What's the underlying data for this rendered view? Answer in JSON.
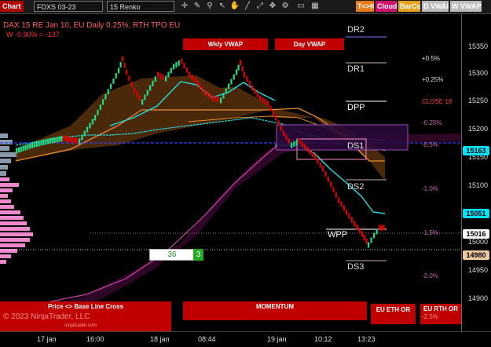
{
  "toolbar": {
    "tab": "Chart",
    "instrument": "FDXS 03-23",
    "bar_type": "15 Renko",
    "badge_tick": "T<>K",
    "badge_cloud": "Cloud",
    "badge_barcol": "BarCol",
    "badge_dvwap": "D VWAP",
    "badge_wvwap": "W VWAP",
    "tool_icons": [
      "crosshair-icon",
      "draw-icon",
      "zoom-icon",
      "pointer-icon",
      "hand-icon",
      "line-icon",
      "arrow-icon",
      "move-icon",
      "config-icon",
      "tab-icon",
      "grid-icon"
    ]
  },
  "header": {
    "title": "DAX 15  RE Jan 10, EU Daily 0.25%, RTH TPO EU",
    "weekly_change": "W -0.90% = -137"
  },
  "buttons": {
    "wkly_vwap": "Wkly VWAP",
    "day_vwap": "Day VWAP",
    "price_cross": "Price <> Base Line Cross",
    "momentum": "MOMENTUM",
    "eu_eth": "EU ETH OR",
    "eu_rth": "EU RTH OR",
    "eu_rth_pct": "-2.5%"
  },
  "levels": [
    "DR2",
    "DR1",
    "DPP",
    "DS1",
    "DS2",
    "WPP",
    "DS3"
  ],
  "pct_labels": [
    "+0.5%",
    "+0.25%",
    "CLOSE 18",
    "-0.25%",
    "-0.5%",
    "-1.0%",
    "-1.5%",
    "-2.0%"
  ],
  "counter": {
    "value": "36",
    "count": "3"
  },
  "copyright": "© 2023 NinjaTrader, LLC",
  "watermark": "ninjatrader.com",
  "price_axis": {
    "ticks": [
      "15350",
      "15300",
      "15250",
      "15200",
      "15150",
      "15100",
      "15050",
      "15000",
      "14950",
      "14900"
    ],
    "labels": [
      {
        "value": "15163",
        "color": "#00e5ff"
      },
      {
        "value": "15051",
        "color": "#00e5ff"
      },
      {
        "value": "15016",
        "color": "#ffffff"
      },
      {
        "value": "14980",
        "color": "#f0c8a0"
      }
    ]
  },
  "time_axis": [
    "17 jan",
    "16:00",
    "18 jan",
    "08:44",
    "19 jan",
    "10:12",
    "13:23"
  ],
  "colors": {
    "bull": "#22dd88",
    "bear": "#e00000",
    "cyan": "#22e0e0",
    "orange": "#e88a30",
    "magenta": "#cc44aa",
    "blue_line": "#3344ff",
    "toolbar_tab": "#b00000"
  }
}
